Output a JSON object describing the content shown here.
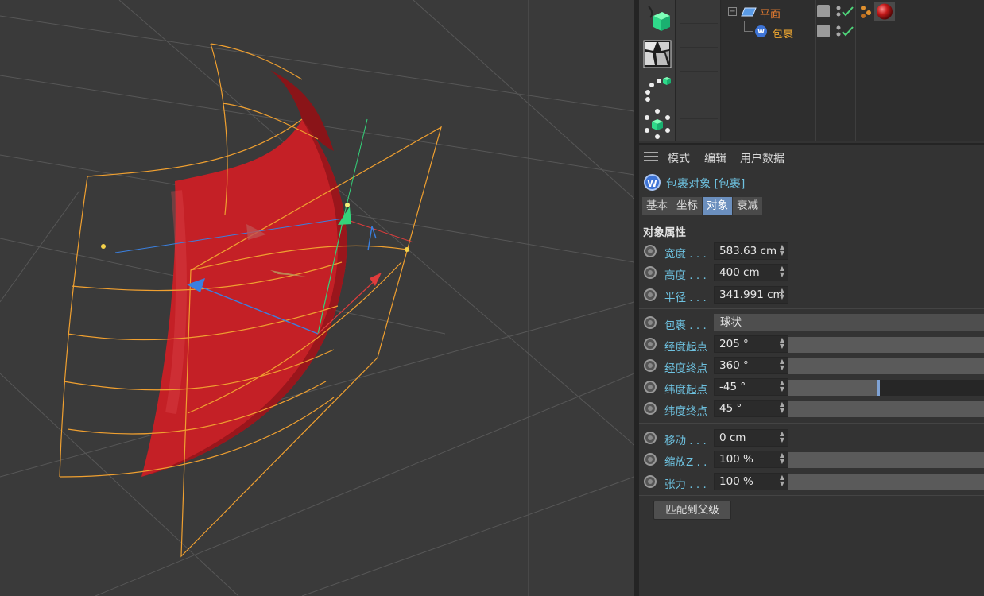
{
  "colors": {
    "viewport_bg": "#3a3a3a",
    "grid": "#5a5a5a",
    "surface_red": "#c42026",
    "cage_orange": "#f0a030",
    "label_cyan": "#6ec2e0",
    "active_tab": "#6b8fbe",
    "axis_x": "#e03c3c",
    "axis_y": "#34d37a",
    "axis_z": "#3a80e0"
  },
  "object_manager": {
    "objects": [
      {
        "name": "平面",
        "icon": "plane-icon",
        "color": "#f08030"
      },
      {
        "name": "包裹",
        "icon": "wrap-deformer-icon",
        "color": "#f0a830"
      }
    ],
    "tools": [
      "cube-icon",
      "voronoi-icon",
      "spline-icon",
      "cloner-icon"
    ]
  },
  "attribute_manager": {
    "menu": [
      "模式",
      "编辑",
      "用户数据"
    ],
    "object_title": "包裹对象 [包裹]",
    "tabs": [
      "基本",
      "坐标",
      "对象",
      "衰减"
    ],
    "active_tab": "对象",
    "section_title": "对象属性",
    "props": {
      "width": {
        "label": "宽度 . . .",
        "value": "583.63 cm"
      },
      "height": {
        "label": "高度 . . .",
        "value": "400 cm"
      },
      "radius": {
        "label": "半径 . . .",
        "value": "341.991 cm"
      },
      "wrap": {
        "label": "包裹 . . .",
        "value": "球状"
      },
      "lon_start": {
        "label": "经度起点",
        "value": "205 °"
      },
      "lon_end": {
        "label": "经度终点",
        "value": "360 °"
      },
      "lat_start": {
        "label": "纬度起点",
        "value": "-45 °",
        "level": 0.455
      },
      "lat_end": {
        "label": "纬度终点",
        "value": "45 °"
      },
      "move": {
        "label": "移动 . . .",
        "value": "0 cm"
      },
      "scale_z": {
        "label": "缩放Z . .",
        "value": "100 %"
      },
      "tension": {
        "label": "张力 . . .",
        "value": "100 %"
      }
    },
    "match_button": "匹配到父级"
  }
}
